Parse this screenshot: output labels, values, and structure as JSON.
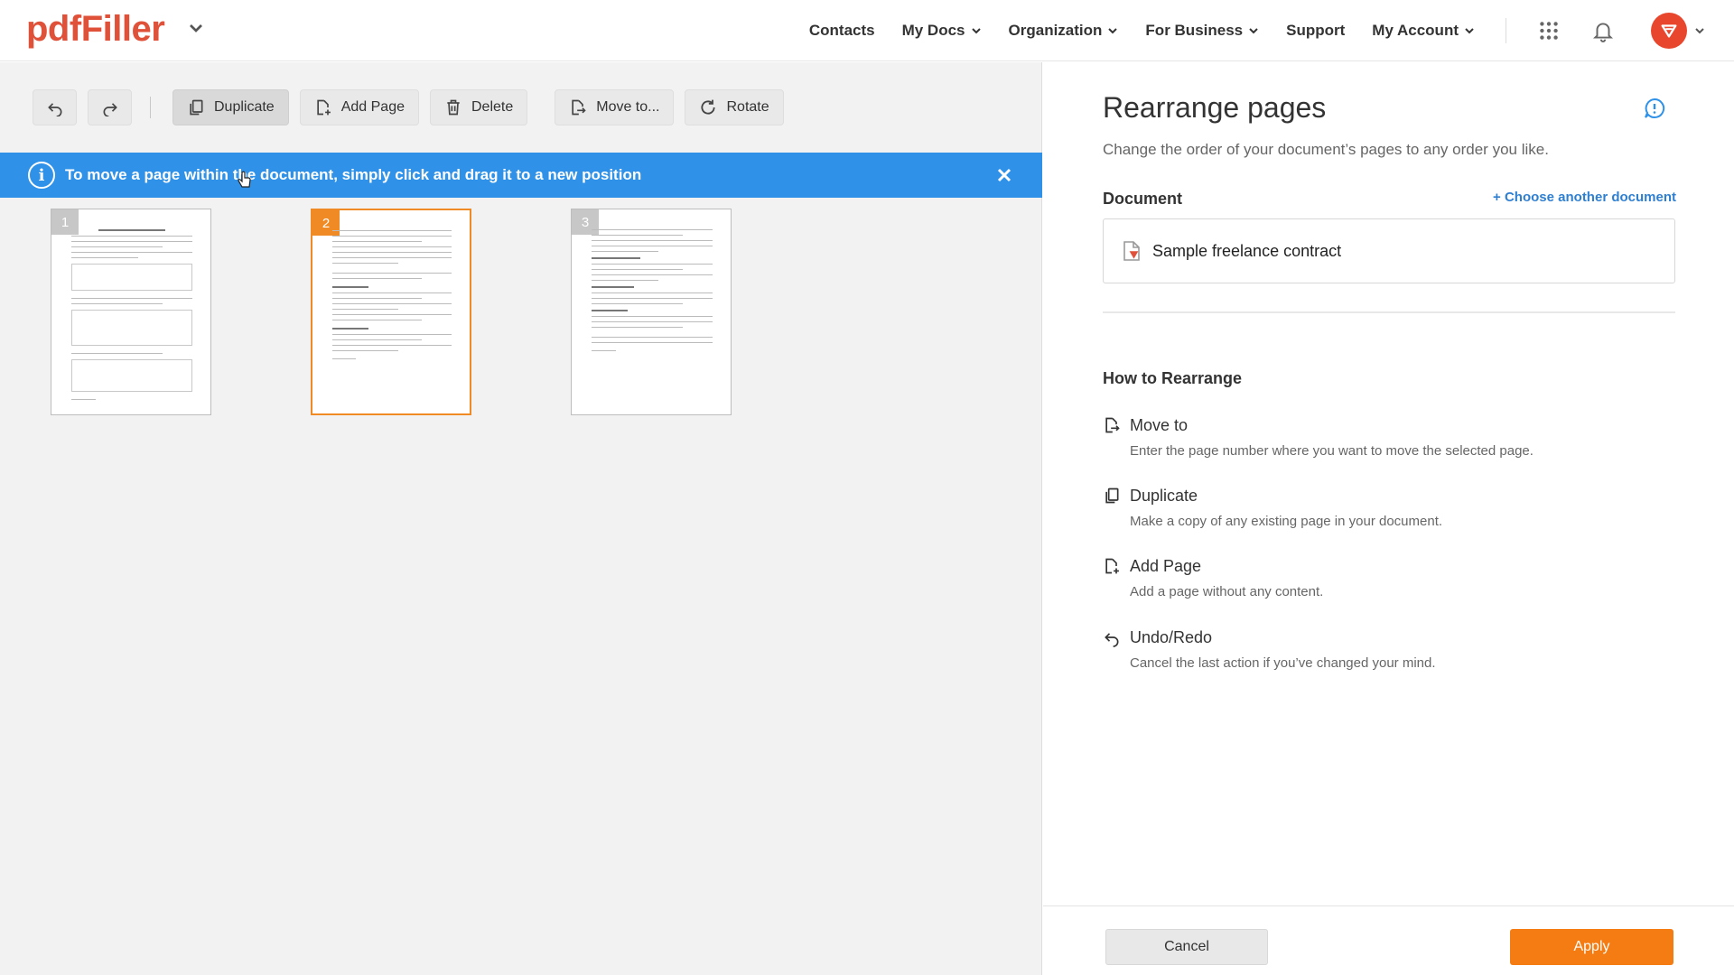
{
  "header": {
    "logo": "pdfFiller",
    "nav": [
      {
        "label": "Contacts",
        "has_dropdown": false
      },
      {
        "label": "My Docs",
        "has_dropdown": true
      },
      {
        "label": "Organization",
        "has_dropdown": true
      },
      {
        "label": "For Business",
        "has_dropdown": true
      },
      {
        "label": "Support",
        "has_dropdown": false
      },
      {
        "label": "My Account",
        "has_dropdown": true
      }
    ],
    "icons": [
      "apps-grid-icon",
      "notification-bell-icon",
      "avatar"
    ]
  },
  "toolbar": {
    "undo_icon": "undo-icon",
    "redo_icon": "redo-icon",
    "duplicate_label": "Duplicate",
    "add_page_label": "Add Page",
    "delete_label": "Delete",
    "move_to_label": "Move to...",
    "rotate_label": "Rotate"
  },
  "banner": {
    "text": "To move a page within the document, simply click and drag it to a new position",
    "color": "#2f92e8"
  },
  "pages": [
    {
      "number": "1",
      "selected": false
    },
    {
      "number": "2",
      "selected": true
    },
    {
      "number": "3",
      "selected": false
    }
  ],
  "panel": {
    "title": "Rearrange pages",
    "subtitle": "Change the order of your document’s pages to any order you like.",
    "document_label": "Document",
    "choose_another": "+ Choose another document",
    "document_name": "Sample freelance contract",
    "how_title": "How to Rearrange",
    "how_items": [
      {
        "title": "Move to",
        "desc": "Enter the page number where you want to move the selected page.",
        "icon": "move-to-icon"
      },
      {
        "title": "Duplicate",
        "desc": "Make a copy of any existing page in your document.",
        "icon": "duplicate-icon"
      },
      {
        "title": "Add Page",
        "desc": "Add a page without any content.",
        "icon": "add-page-icon"
      },
      {
        "title": "Undo/Redo",
        "desc": "Cancel the last action if you’ve changed your mind.",
        "icon": "undo-icon"
      }
    ],
    "cancel_label": "Cancel",
    "apply_label": "Apply"
  },
  "colors": {
    "brand": "#e0513a",
    "accent_orange": "#f47c12",
    "link_blue": "#2f7fd0"
  }
}
